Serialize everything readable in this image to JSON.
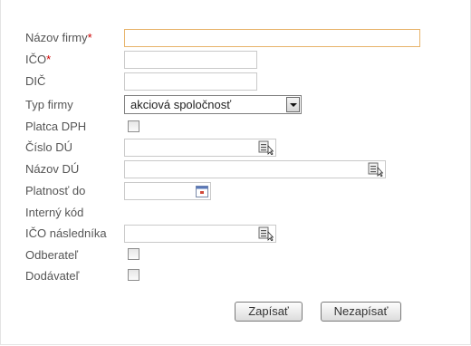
{
  "form": {
    "company_name": {
      "label": "Názov firmy",
      "required_mark": "*",
      "value": ""
    },
    "ico": {
      "label": "IČO",
      "required_mark": "*",
      "value": ""
    },
    "dic": {
      "label": "DIČ",
      "value": ""
    },
    "company_type": {
      "label": "Typ firmy",
      "selected": "akciová spoločnosť"
    },
    "vat_payer": {
      "label": "Platca DPH",
      "checked": false
    },
    "tax_office_number": {
      "label": "Číslo DÚ",
      "value": "",
      "icon": "lookup-icon"
    },
    "tax_office_name": {
      "label": "Názov DÚ",
      "value": "",
      "icon": "lookup-icon"
    },
    "valid_until": {
      "label": "Platnosť do",
      "value": "",
      "icon": "calendar-icon"
    },
    "internal_code": {
      "label": "Interný kód"
    },
    "successor_ico": {
      "label": "IČO následníka",
      "value": "",
      "icon": "lookup-icon"
    },
    "customer": {
      "label": "Odberateľ",
      "checked": false
    },
    "supplier": {
      "label": "Dodávateľ",
      "checked": false
    }
  },
  "buttons": {
    "save_label": "Zapísať",
    "cancel_label": "Nezapísať"
  },
  "colors": {
    "required": "#cc0000",
    "focus_border": "#e7b36a",
    "label_text": "#555555"
  }
}
